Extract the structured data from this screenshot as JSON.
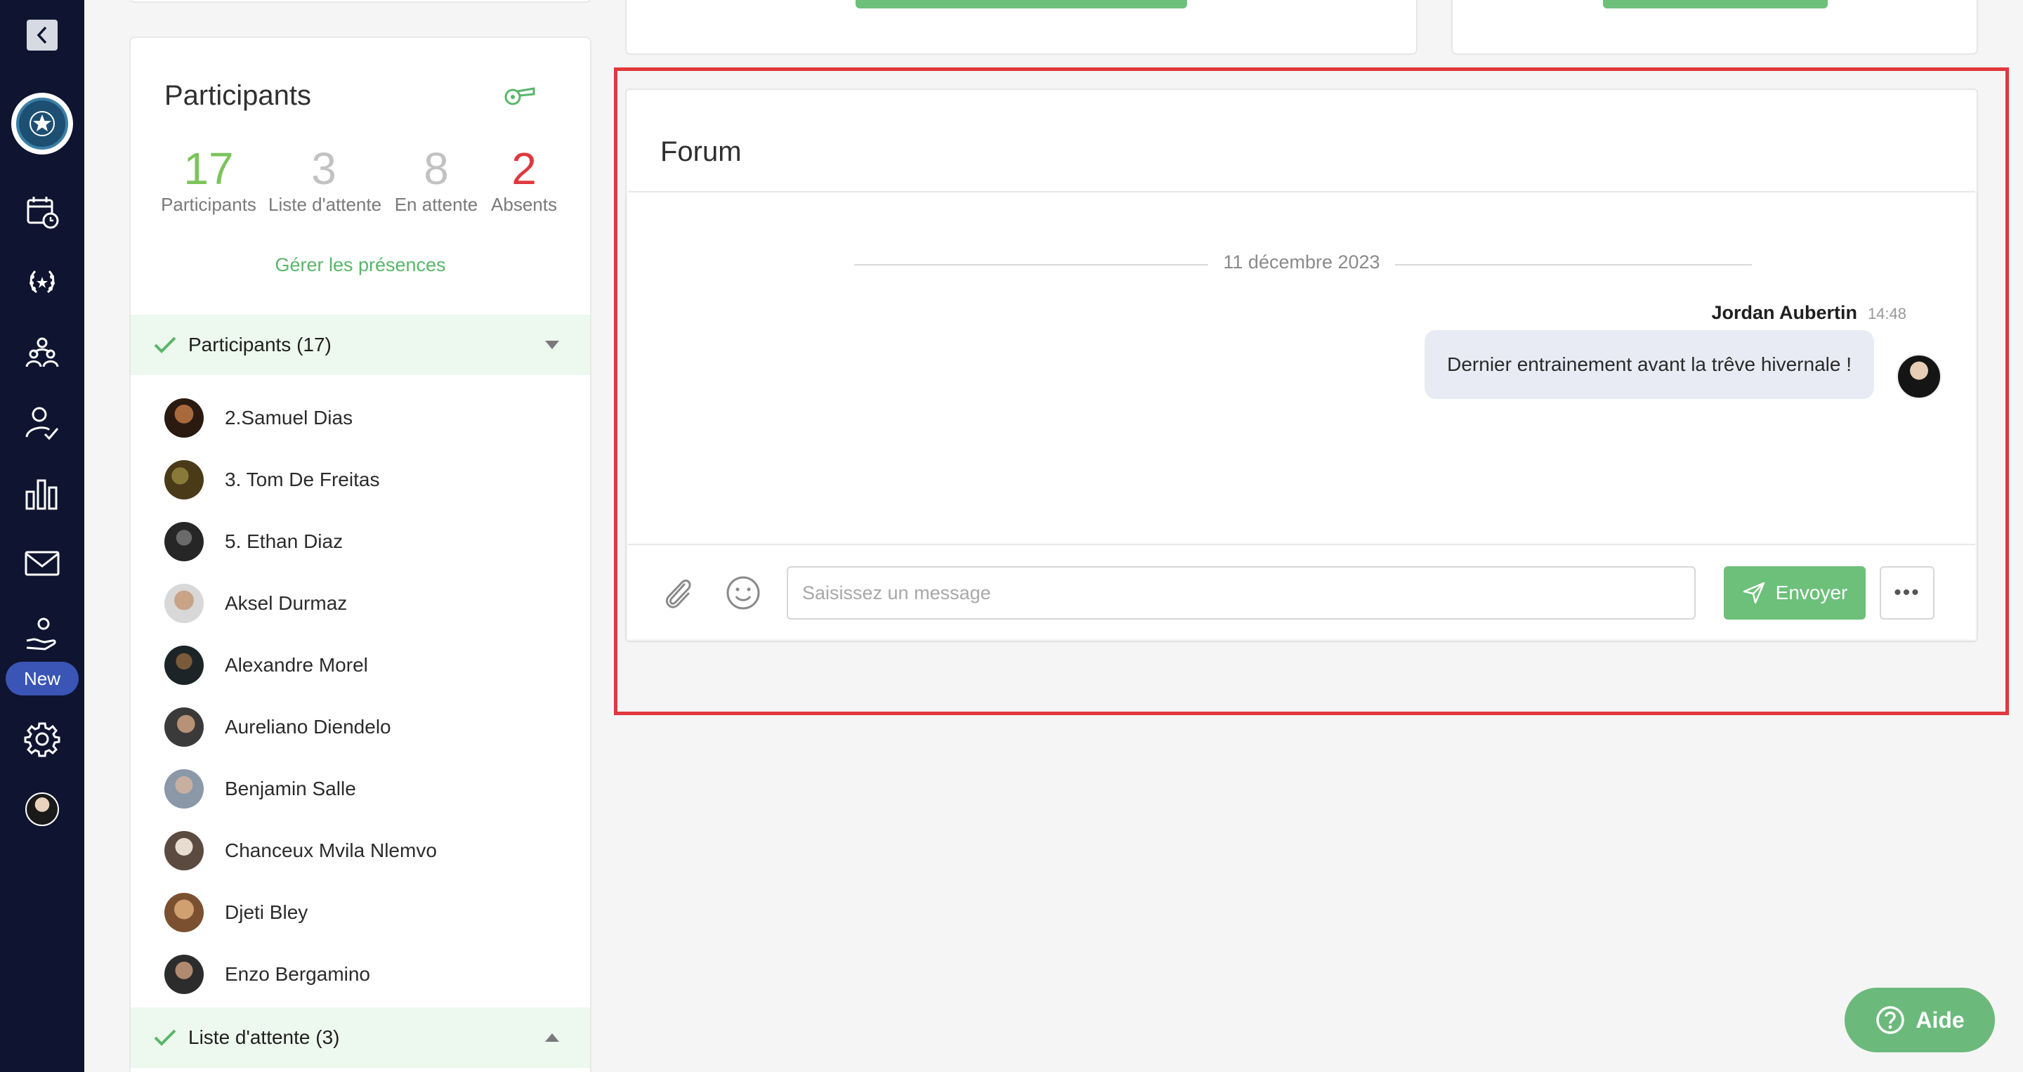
{
  "sidebar": {
    "new_badge": "New"
  },
  "participants_panel": {
    "title": "Participants",
    "stats": [
      {
        "value": "17",
        "label": "Participants",
        "color": "#7cc35c"
      },
      {
        "value": "3",
        "label": "Liste d'attente",
        "color": "#c2c2c2"
      },
      {
        "value": "8",
        "label": "En attente",
        "color": "#c2c2c2"
      },
      {
        "value": "2",
        "label": "Absents",
        "color": "#e0383e"
      }
    ],
    "manage_link": "Gérer les présences",
    "participants_section": "Participants (17)",
    "members": [
      {
        "name": "2.Samuel Dias"
      },
      {
        "name": "3. Tom De Freitas"
      },
      {
        "name": "5. Ethan Diaz"
      },
      {
        "name": "Aksel Durmaz"
      },
      {
        "name": "Alexandre Morel"
      },
      {
        "name": "Aureliano Diendelo"
      },
      {
        "name": "Benjamin Salle"
      },
      {
        "name": "Chanceux Mvila Nlemvo"
      },
      {
        "name": "Djeti Bley"
      },
      {
        "name": "Enzo Bergamino"
      }
    ],
    "waitlist_section": "Liste d'attente (3)"
  },
  "forum": {
    "title": "Forum",
    "date_separator": "11 décembre 2023",
    "message": {
      "author": "Jordan Aubertin",
      "time": "14:48",
      "text": "Dernier entrainement avant la trêve hivernale !"
    },
    "input_placeholder": "Saisissez un message",
    "send_label": "Envoyer",
    "more_label": "•••"
  },
  "help_button": "Aide",
  "colors": {
    "sidebar_bg": "#0f1430",
    "accent_green": "#6cc07a",
    "highlight_red": "#e0383e",
    "badge_blue": "#3a55b5"
  }
}
